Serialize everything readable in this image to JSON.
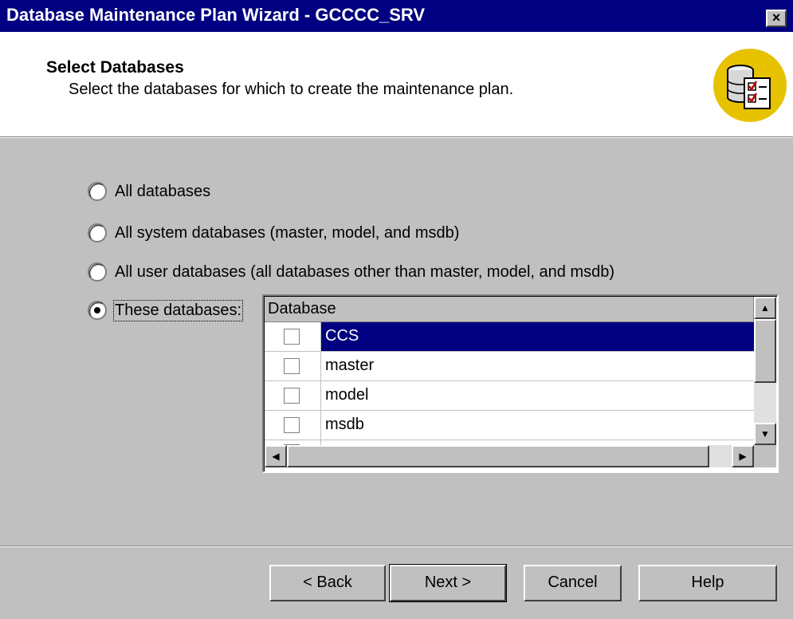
{
  "window": {
    "title": "Database Maintenance Plan Wizard - GCCCC_SRV",
    "close_glyph": "×"
  },
  "header": {
    "title": "Select Databases",
    "subtitle": "Select the databases for which to create the maintenance plan.",
    "icon": "database-checklist-icon"
  },
  "options": [
    {
      "label": "All databases",
      "selected": false
    },
    {
      "label": "All system databases (master, model, and msdb)",
      "selected": false
    },
    {
      "label": "All user databases (all databases other than master, model, and msdb)",
      "selected": false
    },
    {
      "label": "These databases:",
      "selected": true
    }
  ],
  "grid": {
    "column_header": "Database",
    "rows": [
      {
        "name": "CCS",
        "checked": false,
        "selected": true
      },
      {
        "name": "master",
        "checked": false,
        "selected": false
      },
      {
        "name": "model",
        "checked": false,
        "selected": false
      },
      {
        "name": "msdb",
        "checked": false,
        "selected": false
      }
    ]
  },
  "buttons": {
    "back": "< Back",
    "next": "Next >",
    "cancel": "Cancel",
    "help": "Help"
  },
  "colors": {
    "titlebar": "#000080",
    "selection": "#000080",
    "dialog_face": "#c0c0c0",
    "icon_circle": "#e6c200"
  }
}
